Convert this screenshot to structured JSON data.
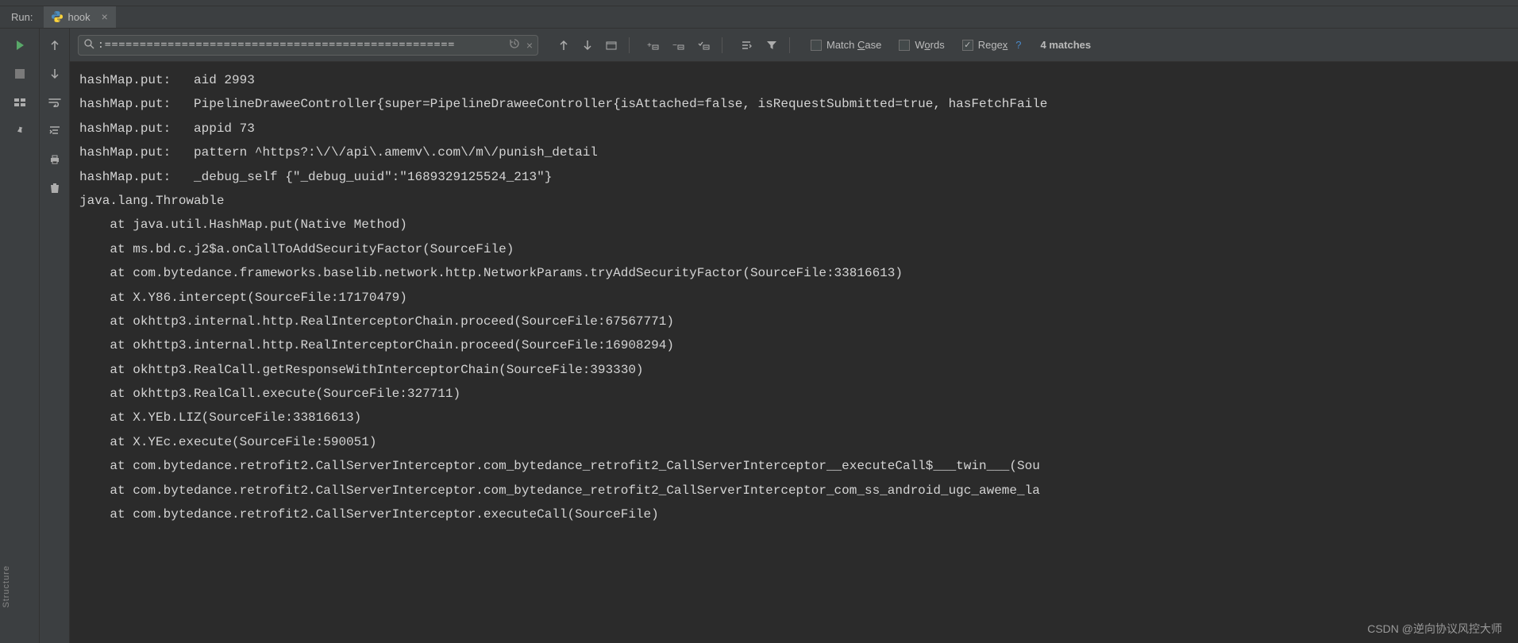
{
  "run_label": "Run:",
  "tab": {
    "name": "hook"
  },
  "search": {
    "value": ":==================================================",
    "match_case_label": "Match Case",
    "words_label": "Words",
    "regex_label": "Regex",
    "regex_checked": true,
    "match_count": "4 matches"
  },
  "console_lines": [
    "hashMap.put:   aid 2993",
    "hashMap.put:   PipelineDraweeController{super=PipelineDraweeController{isAttached=false, isRequestSubmitted=true, hasFetchFaile",
    "hashMap.put:   appid 73",
    "hashMap.put:   pattern ^https?:\\/\\/api\\.amemv\\.com\\/m\\/punish_detail",
    "hashMap.put:   _debug_self {\"_debug_uuid\":\"1689329125524_213\"}",
    "java.lang.Throwable",
    "    at java.util.HashMap.put(Native Method)",
    "    at ms.bd.c.j2$a.onCallToAddSecurityFactor(SourceFile)",
    "    at com.bytedance.frameworks.baselib.network.http.NetworkParams.tryAddSecurityFactor(SourceFile:33816613)",
    "    at X.Y86.intercept(SourceFile:17170479)",
    "    at okhttp3.internal.http.RealInterceptorChain.proceed(SourceFile:67567771)",
    "    at okhttp3.internal.http.RealInterceptorChain.proceed(SourceFile:16908294)",
    "    at okhttp3.RealCall.getResponseWithInterceptorChain(SourceFile:393330)",
    "    at okhttp3.RealCall.execute(SourceFile:327711)",
    "    at X.YEb.LIZ(SourceFile:33816613)",
    "    at X.YEc.execute(SourceFile:590051)",
    "    at com.bytedance.retrofit2.CallServerInterceptor.com_bytedance_retrofit2_CallServerInterceptor__executeCall$___twin___(Sou",
    "    at com.bytedance.retrofit2.CallServerInterceptor.com_bytedance_retrofit2_CallServerInterceptor_com_ss_android_ugc_aweme_la",
    "    at com.bytedance.retrofit2.CallServerInterceptor.executeCall(SourceFile)"
  ],
  "watermark": "CSDN @逆向协议风控大师",
  "structure_label": "Structure"
}
